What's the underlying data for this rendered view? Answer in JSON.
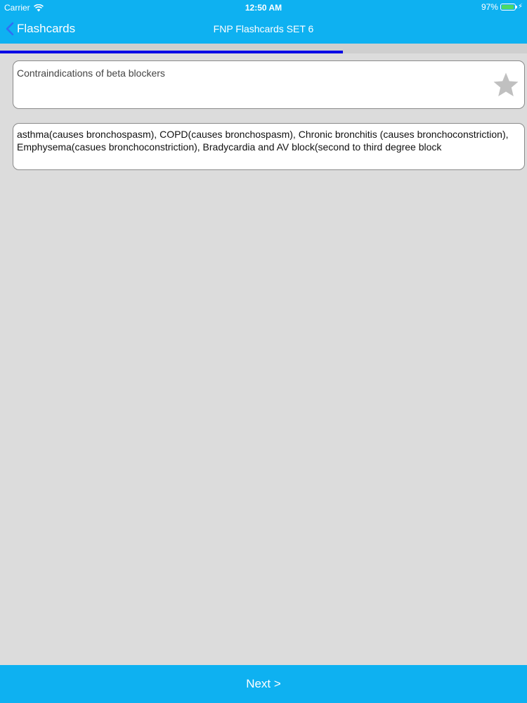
{
  "status_bar": {
    "carrier": "Carrier",
    "time": "12:50 AM",
    "battery_percent": "97%",
    "battery_level": 0.97,
    "wifi_icon": "wifi-icon",
    "charging_icon": "bolt-icon"
  },
  "nav": {
    "back_label": "Flashcards",
    "back_icon": "chevron-left-icon",
    "title": "FNP Flashcards SET 6"
  },
  "progress": {
    "fraction": 0.65
  },
  "question": {
    "text": "Contraindications of beta blockers",
    "favorite_icon": "star-icon"
  },
  "answer": {
    "text": "asthma(causes bronchospasm), COPD(causes bronchospasm), Chronic bronchitis (causes bronchoconstriction), Emphysema(casues bronchoconstriction), Bradycardia and AV block(second to third degree block"
  },
  "footer": {
    "next_label": "Next >"
  },
  "colors": {
    "bar": "#0eb1f1",
    "background": "#dcdcdc",
    "progress": "#0000e6",
    "battery": "#4cd964",
    "star": "#c0c0c0"
  }
}
